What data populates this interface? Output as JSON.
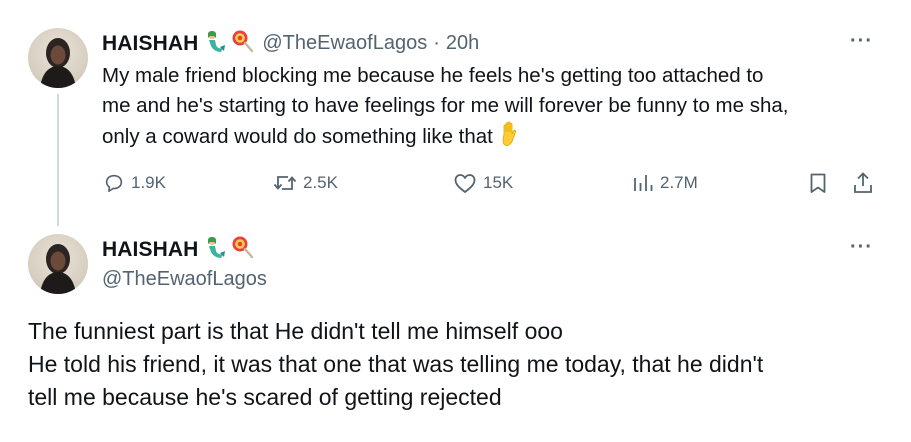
{
  "tweet1": {
    "display_name": "HAISHAH",
    "name_emojis": [
      "mermaid-emoji",
      "lollipop-emoji"
    ],
    "handle": "@TheEwaofLagos",
    "separator": "·",
    "time": "20h",
    "text": "My male friend blocking me because he feels he's getting too attached to\nme and he's starting to have feelings for me will forever be funny to me sha,\nonly a coward would do something like that",
    "trailing_emoji": "raised-hand-emoji",
    "more_label": "···",
    "actions": {
      "replies": "1.9K",
      "reposts": "2.5K",
      "likes": "15K",
      "views": "2.7M"
    }
  },
  "tweet2": {
    "display_name": "HAISHAH",
    "name_emojis": [
      "mermaid-emoji",
      "lollipop-emoji"
    ],
    "handle": "@TheEwaofLagos",
    "more_label": "···",
    "text": "The funniest part is that He didn't tell me himself ooo\nHe told his friend, it was that one that was telling me today, that he didn't\ntell me because he's scared of getting rejected"
  },
  "colors": {
    "text_primary": "#0f1419",
    "text_secondary": "#536471",
    "thread_line": "#cfd9de"
  }
}
